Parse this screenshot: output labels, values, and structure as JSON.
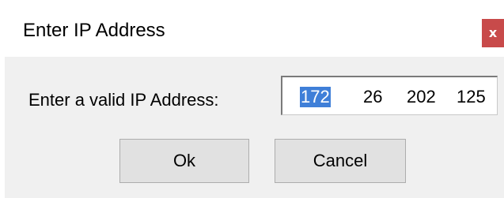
{
  "dialog": {
    "title": "Enter IP Address",
    "close_label": "x",
    "prompt": "Enter a valid IP Address:",
    "ip_octets": [
      "172",
      "26",
      "202",
      "125"
    ],
    "selected_octet_index": 0,
    "ok_label": "Ok",
    "cancel_label": "Cancel"
  },
  "colors": {
    "close_button": "#c84a4a",
    "selection": "#3f7fd8",
    "dialog_background": "#f0f0f0",
    "button_background": "#e1e1e1"
  }
}
